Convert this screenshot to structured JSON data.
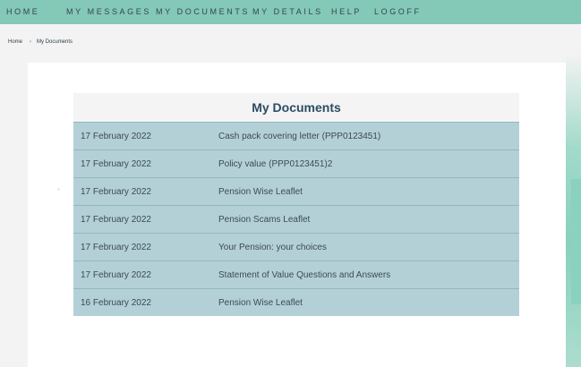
{
  "nav": {
    "items": [
      {
        "label": "HOME"
      },
      {
        "label": "MY MESSAGES"
      },
      {
        "label": "MY DOCUMENTS"
      },
      {
        "label": "MY DETAILS"
      },
      {
        "label": "HELP"
      },
      {
        "label": "LOGOFF"
      }
    ]
  },
  "breadcrumb": {
    "home": "Home",
    "separator": "›",
    "current": "My Documents"
  },
  "documents": {
    "heading": "My Documents",
    "rows": [
      {
        "date": "17 February 2022",
        "title": "Cash pack covering letter (PPP0123451)"
      },
      {
        "date": "17 February 2022",
        "title": "Policy value (PPP0123451)2"
      },
      {
        "date": "17 February 2022",
        "title": "Pension Wise Leaflet"
      },
      {
        "date": "17 February 2022",
        "title": "Pension Scams Leaflet"
      },
      {
        "date": "17 February 2022",
        "title": "Your Pension: your choices"
      },
      {
        "date": "17 February 2022",
        "title": "Statement of Value Questions and Answers"
      },
      {
        "date": "16 February 2022",
        "title": "Pension Wise Leaflet"
      }
    ]
  },
  "colors": {
    "nav_bg": "#84c8b7",
    "row_bg": "#b4d0d7",
    "heading_color": "#2c4c63"
  }
}
